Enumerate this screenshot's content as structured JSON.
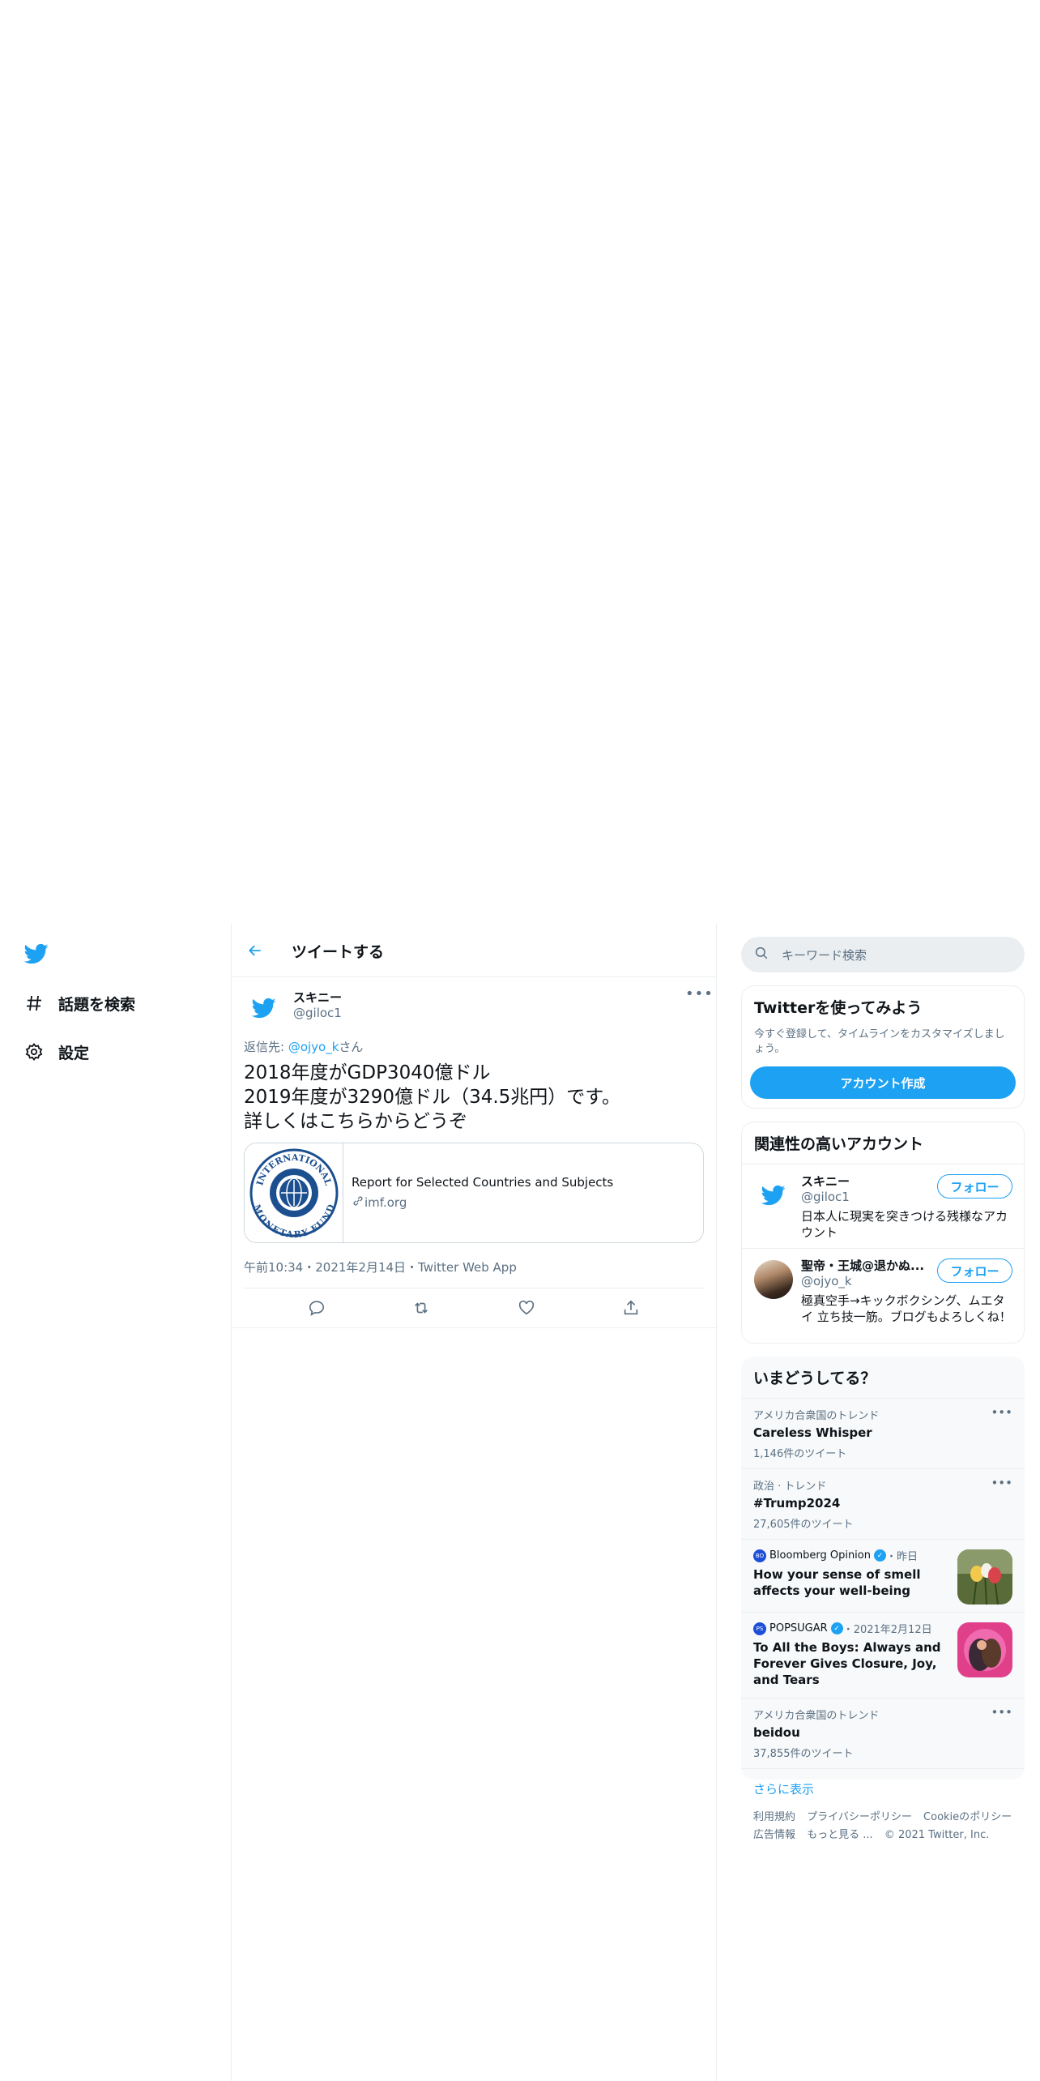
{
  "nav": {
    "items": [
      {
        "label": "話題を検索",
        "icon": "hashtag-icon"
      },
      {
        "label": "設定",
        "icon": "gear-icon"
      }
    ]
  },
  "main": {
    "header_title": "ツイートする",
    "tweet": {
      "author_name": "スキニー",
      "author_handle": "@giloc1",
      "reply_prefix": "返信先: ",
      "reply_handle": "@ojyo_k",
      "reply_suffix": "さん",
      "text_lines": [
        "2018年度がGDP3040億ドル",
        "2019年度が3290億ドル（34.5兆円）です。",
        "詳しくはこちらからどうぞ"
      ],
      "card": {
        "title": "Report for Selected Countries and Subjects",
        "domain": "imf.org",
        "seal_text_top": "INTERNATIONAL",
        "seal_text_bottom": "MONETARY FUND"
      },
      "meta": "午前10:34・2021年2月14日・Twitter Web App"
    }
  },
  "right": {
    "search_placeholder": "キーワード検索",
    "signup": {
      "title": "Twitterを使ってみよう",
      "desc": "今すぐ登録して、タイムラインをカスタマイズしましょう。",
      "button": "アカウント作成"
    },
    "relevant": {
      "title": "関連性の高いアカウント",
      "accounts": [
        {
          "name": "スキニー",
          "handle": "@giloc1",
          "bio": "日本人に現実を突きつける残様なアカウント",
          "follow": "フォロー"
        },
        {
          "name": "聖帝・王城@退かぬ...",
          "handle": "@ojyo_k",
          "bio": "極真空手→キックボクシング、ムエタイ 立ち技一筋。ブログもよろしくね！",
          "follow": "フォロー"
        }
      ]
    },
    "trends": {
      "title": "いまどうしてる？",
      "items": [
        {
          "meta": "アメリカ合衆国のトレンド",
          "title": "Careless Whisper",
          "count": "1,146件のツイート"
        },
        {
          "meta": "政治 · トレンド",
          "title": "#Trump2024",
          "count": "27,605件のツイート"
        }
      ],
      "news": [
        {
          "source": "Bloomberg Opinion",
          "time": "・昨日",
          "title": "How your sense of smell affects your well-being",
          "logo": "BO"
        },
        {
          "source": "POPSUGAR",
          "time": "・2021年2月12日",
          "title": "To All the Boys: Always and Forever Gives Closure, Joy, and Tears",
          "logo": "PS"
        }
      ],
      "last": {
        "meta": "アメリカ合衆国のトレンド",
        "title": "beidou",
        "count": "37,855件のツイート"
      },
      "show_more": "さらに表示"
    },
    "footer": {
      "line1": [
        "利用規約",
        "プライバシーポリシー",
        "Cookieのポリシー"
      ],
      "line2": [
        "広告情報",
        "もっと見る ...",
        "© 2021 Twitter, Inc."
      ]
    }
  },
  "colors": {
    "accent": "#1da1f2",
    "text": "#0f1419",
    "muted": "#5b7083",
    "border": "#ebeef0"
  }
}
